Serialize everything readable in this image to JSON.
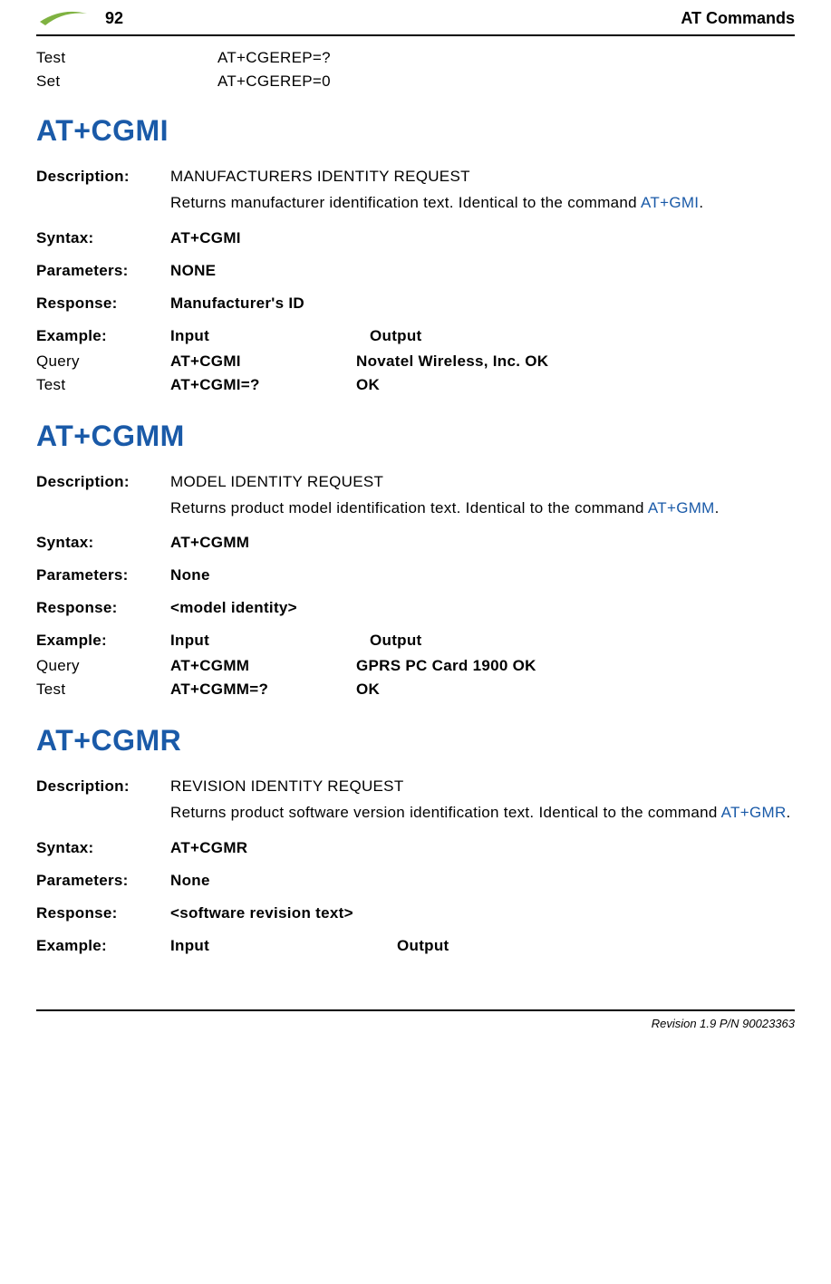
{
  "header": {
    "page_number": "92",
    "title": "AT Commands"
  },
  "top_rows": [
    {
      "label": "Test",
      "value": "AT+CGEREP=?"
    },
    {
      "label": "Set",
      "value": "AT+CGEREP=0"
    }
  ],
  "sections": [
    {
      "title": "AT+CGMI",
      "description_label": "Description:",
      "description_value": "MANUFACTURERS IDENTITY REQUEST",
      "description_extra_pre": "Returns manufacturer identification text. Identical to the command ",
      "description_extra_link": "AT+GMI",
      "description_extra_post": ".",
      "syntax_label": "Syntax:",
      "syntax_value": "AT+CGMI",
      "parameters_label": "Parameters:",
      "parameters_value": "NONE",
      "response_label": "Response:",
      "response_value": "Manufacturer's ID",
      "example_label": "Example:",
      "example_input_header": "Input",
      "example_output_header": "Output",
      "example_rows": [
        {
          "c1": "Query",
          "c2": "AT+CGMI",
          "c3": "Novatel Wireless, Inc. OK"
        },
        {
          "c1": "Test",
          "c2": "AT+CGMI=?",
          "c3": "OK"
        }
      ]
    },
    {
      "title": "AT+CGMM",
      "description_label": "Description:",
      "description_value": "MODEL IDENTITY REQUEST",
      "description_extra_pre": "Returns product model identification text. Identical to the command ",
      "description_extra_link": "AT+GMM",
      "description_extra_post": ".",
      "syntax_label": "Syntax:",
      "syntax_value": "AT+CGMM",
      "parameters_label": "Parameters:",
      "parameters_value": "None",
      "response_label": "Response:",
      "response_value": "<model identity>",
      "example_label": "Example:",
      "example_input_header": "Input",
      "example_output_header": "Output",
      "example_rows": [
        {
          "c1": "Query",
          "c2": "AT+CGMM",
          "c3": "GPRS PC Card 1900 OK"
        },
        {
          "c1": "Test",
          "c2": "AT+CGMM=?",
          "c3": "OK"
        }
      ]
    },
    {
      "title": "AT+CGMR",
      "description_label": "Description:",
      "description_value": "REVISION IDENTITY REQUEST",
      "description_extra_pre": "Returns product software version identification text. Identical to the command ",
      "description_extra_link": "AT+GMR",
      "description_extra_post": ".",
      "syntax_label": "Syntax:",
      "syntax_value": "AT+CGMR",
      "parameters_label": "Parameters:",
      "parameters_value": "None",
      "response_label": "Response:",
      "response_value": "<software revision text>",
      "example_label": "Example:",
      "example_input_header": "Input",
      "example_output_header": "Output",
      "example_rows": []
    }
  ],
  "footer": {
    "revision": "Revision 1.9 P/N 90023363"
  }
}
